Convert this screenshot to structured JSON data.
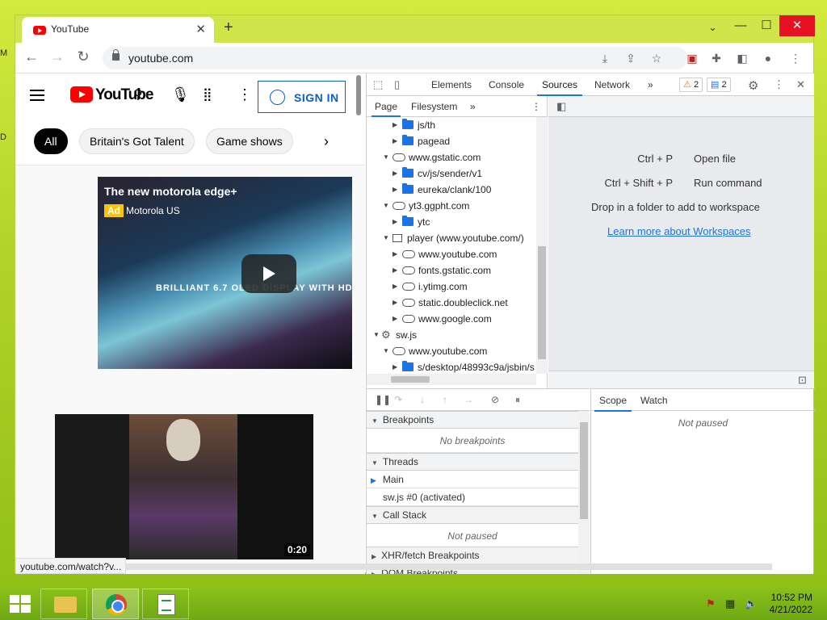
{
  "browser": {
    "tab_title": "YouTube",
    "tab_close": "✕",
    "new_tab": "+",
    "tab_search": "⌄",
    "window_controls": {
      "minimize": "—",
      "maximize": "☐",
      "close": "✕"
    },
    "url": "youtube.com",
    "status_url": "youtube.com/watch?v..."
  },
  "youtube": {
    "logo_text": "YouTube",
    "sign_in": "SIGN IN",
    "chips": [
      "All",
      "Britain's Got Talent",
      "Game shows"
    ],
    "chip_next": "›",
    "ad": {
      "title": "The new motorola edge+",
      "badge": "Ad",
      "advertiser": "Motorola US",
      "overlay": "BRILLIANT 6.7 OLED DISPLAY WITH HD"
    },
    "video2": {
      "duration": "0:20"
    }
  },
  "devtools": {
    "tabs": [
      "Elements",
      "Console",
      "Sources",
      "Network"
    ],
    "more_tabs": "»",
    "warnings": "2",
    "messages": "2",
    "navigator_tabs": [
      "Page",
      "Filesystem"
    ],
    "navigator_more": "»",
    "tree": [
      {
        "label": "js/th",
        "kind": "folder",
        "depth": 2,
        "expanded": false
      },
      {
        "label": "pagead",
        "kind": "folder",
        "depth": 2,
        "expanded": false
      },
      {
        "label": "www.gstatic.com",
        "kind": "cloud",
        "depth": 1,
        "expanded": true
      },
      {
        "label": "cv/js/sender/v1",
        "kind": "folder",
        "depth": 2,
        "expanded": false
      },
      {
        "label": "eureka/clank/100",
        "kind": "folder",
        "depth": 2,
        "expanded": false
      },
      {
        "label": "yt3.ggpht.com",
        "kind": "cloud",
        "depth": 1,
        "expanded": true
      },
      {
        "label": "ytc",
        "kind": "folder",
        "depth": 2,
        "expanded": false
      },
      {
        "label": "player (www.youtube.com/)",
        "kind": "frame",
        "depth": 1,
        "expanded": true
      },
      {
        "label": "www.youtube.com",
        "kind": "cloud",
        "depth": 2,
        "expanded": false
      },
      {
        "label": "fonts.gstatic.com",
        "kind": "cloud",
        "depth": 2,
        "expanded": false
      },
      {
        "label": "i.ytimg.com",
        "kind": "cloud",
        "depth": 2,
        "expanded": false
      },
      {
        "label": "static.doubleclick.net",
        "kind": "cloud",
        "depth": 2,
        "expanded": false
      },
      {
        "label": "www.google.com",
        "kind": "cloud",
        "depth": 2,
        "expanded": false
      },
      {
        "label": "sw.js",
        "kind": "gear",
        "depth": 0,
        "expanded": true
      },
      {
        "label": "www.youtube.com",
        "kind": "cloud",
        "depth": 1,
        "expanded": true
      },
      {
        "label": "s/desktop/48993c9a/jsbin/s",
        "kind": "folder",
        "depth": 2,
        "expanded": false
      }
    ],
    "editor": {
      "shortcuts": [
        {
          "key": "Ctrl + P",
          "desc": "Open file"
        },
        {
          "key": "Ctrl + Shift + P",
          "desc": "Run command"
        }
      ],
      "drop_text": "Drop in a folder to add to workspace",
      "learn_more": "Learn more about Workspaces"
    },
    "sections": {
      "breakpoints": "Breakpoints",
      "no_breakpoints": "No breakpoints",
      "threads": "Threads",
      "thread_main": "Main",
      "thread_sw": "sw.js #0 (activated)",
      "call_stack": "Call Stack",
      "not_paused": "Not paused",
      "xhr": "XHR/fetch Breakpoints",
      "dom": "DOM Breakpoints"
    },
    "scope_tabs": [
      "Scope",
      "Watch"
    ],
    "scope_not_paused": "Not paused"
  },
  "taskbar": {
    "time": "10:52 PM",
    "date": "4/21/2022"
  },
  "colors": {
    "accent": "#1a73e8",
    "youtube_red": "#ff0000",
    "desktop": "#9cc41a"
  }
}
